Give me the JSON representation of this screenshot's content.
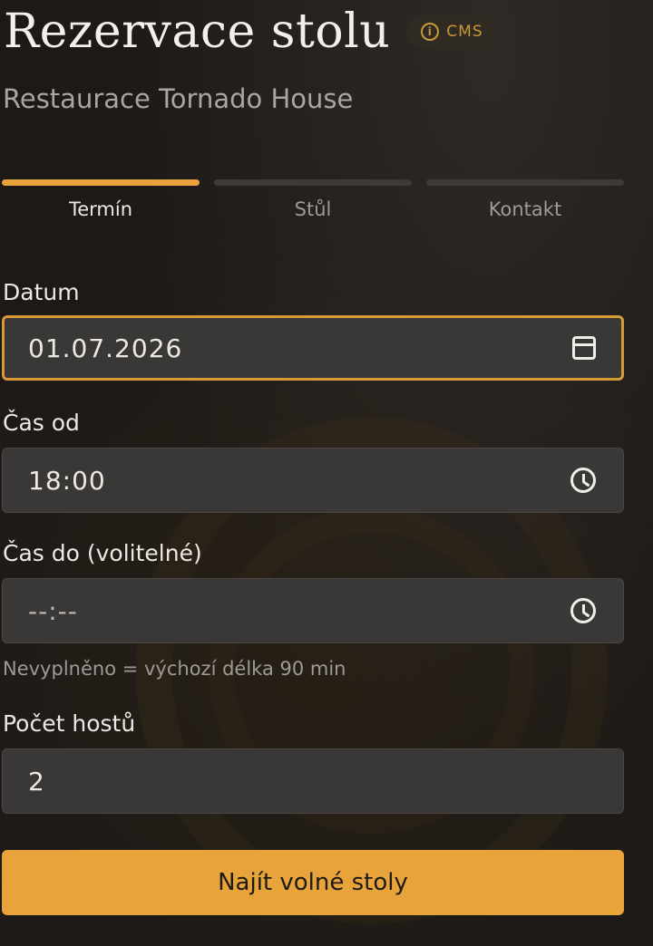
{
  "header": {
    "title": "Rezervace stolu",
    "badge_label": "CMS",
    "subtitle": "Restaurace Tornado House"
  },
  "steps": [
    {
      "label": "Termín",
      "active": true
    },
    {
      "label": "Stůl",
      "active": false
    },
    {
      "label": "Kontakt",
      "active": false
    }
  ],
  "form": {
    "date": {
      "label": "Datum",
      "value": "01.07.2026",
      "icon": "calendar-icon"
    },
    "time_from": {
      "label": "Čas od",
      "value": "18:00",
      "icon": "clock-icon"
    },
    "time_to": {
      "label": "Čas do (volitelné)",
      "placeholder": "--:--",
      "icon": "clock-icon",
      "hint": "Nevyplněno = výchozí délka 90 min"
    },
    "guests": {
      "label": "Počet hostů",
      "value": "2"
    },
    "submit_label": "Najít volné stoly"
  },
  "colors": {
    "accent": "#e8a33a",
    "background": "#1c1917",
    "input_bg": "#3a3836"
  }
}
